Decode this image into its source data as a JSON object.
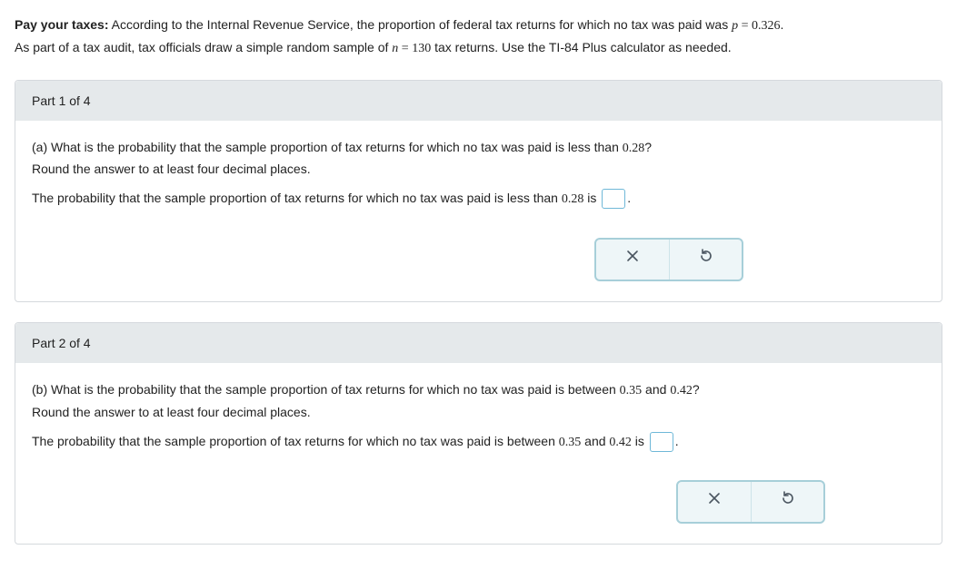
{
  "intro": {
    "bold_label": "Pay your taxes:",
    "line1_a": " According to the Internal Revenue Service, the proportion of federal tax returns for which no tax was paid was ",
    "p_var": "p",
    "p_eq": " = ",
    "p_val": "0.326",
    "line1_end": ".",
    "line2_a": "As part of a tax audit, tax officials draw a simple random sample of ",
    "n_var": "n",
    "n_eq": " = ",
    "n_val": "130",
    "line2_b": " tax returns. Use the TI-84 Plus calculator as needed."
  },
  "part1": {
    "header": "Part 1 of 4",
    "q_a": "(a) What is the probability that the sample proportion of tax returns for which no tax was paid is less than ",
    "q_val": "0.28",
    "q_end": "?",
    "round": "Round the answer to at least four decimal places.",
    "ans_a": "The probability that the sample proportion of tax returns for which no tax was paid is less than ",
    "ans_val": "0.28",
    "ans_b": " is ",
    "ans_end": "."
  },
  "part2": {
    "header": "Part 2 of 4",
    "q_a": "(b) What is the probability that the sample proportion of tax returns for which no tax was paid is between ",
    "q_v1": "0.35",
    "q_mid": " and ",
    "q_v2": "0.42",
    "q_end": "?",
    "round": "Round the answer to at least four decimal places.",
    "ans_a": "The probability that the sample proportion of tax returns for which no tax was paid is between ",
    "ans_v1": "0.35",
    "ans_mid": " and ",
    "ans_v2": "0.42",
    "ans_b": " is ",
    "ans_end": "."
  }
}
